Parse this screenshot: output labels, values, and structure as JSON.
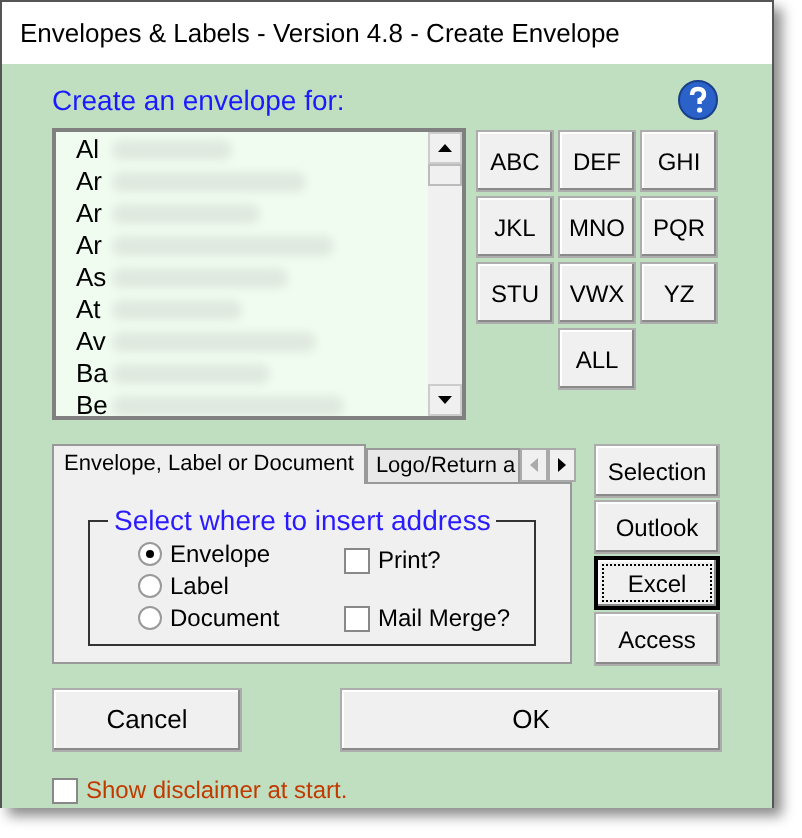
{
  "window": {
    "title": "Envelopes & Labels - Version 4.8 - Create Envelope"
  },
  "heading": "Create an envelope for:",
  "contacts": [
    {
      "name": "Al"
    },
    {
      "name": "Ar"
    },
    {
      "name": "Ar"
    },
    {
      "name": "Ar"
    },
    {
      "name": "As"
    },
    {
      "name": "At"
    },
    {
      "name": "Av"
    },
    {
      "name": "Ba"
    },
    {
      "name": "Be"
    }
  ],
  "letter_buttons": [
    "ABC",
    "DEF",
    "GHI",
    "JKL",
    "MNO",
    "PQR",
    "STU",
    "VWX",
    "YZ",
    "ALL"
  ],
  "tabs": [
    {
      "label": "Envelope, Label or Document",
      "selected": true
    },
    {
      "label": "Logo/Return a",
      "selected": false
    }
  ],
  "group": {
    "title": "Select where to insert address",
    "options": [
      {
        "label": "Envelope",
        "selected": true
      },
      {
        "label": "Label",
        "selected": false
      },
      {
        "label": "Document",
        "selected": false
      }
    ],
    "checks": [
      {
        "label": "Print?",
        "checked": false
      },
      {
        "label": "Mail Merge?",
        "checked": false
      }
    ]
  },
  "source_buttons": [
    {
      "label": "Selection",
      "focused": false
    },
    {
      "label": "Outlook",
      "focused": false
    },
    {
      "label": "Excel",
      "focused": true
    },
    {
      "label": "Access",
      "focused": false
    }
  ],
  "cancel": "Cancel",
  "ok": "OK",
  "disclaimer": {
    "label": "Show disclaimer at start.",
    "checked": false
  }
}
